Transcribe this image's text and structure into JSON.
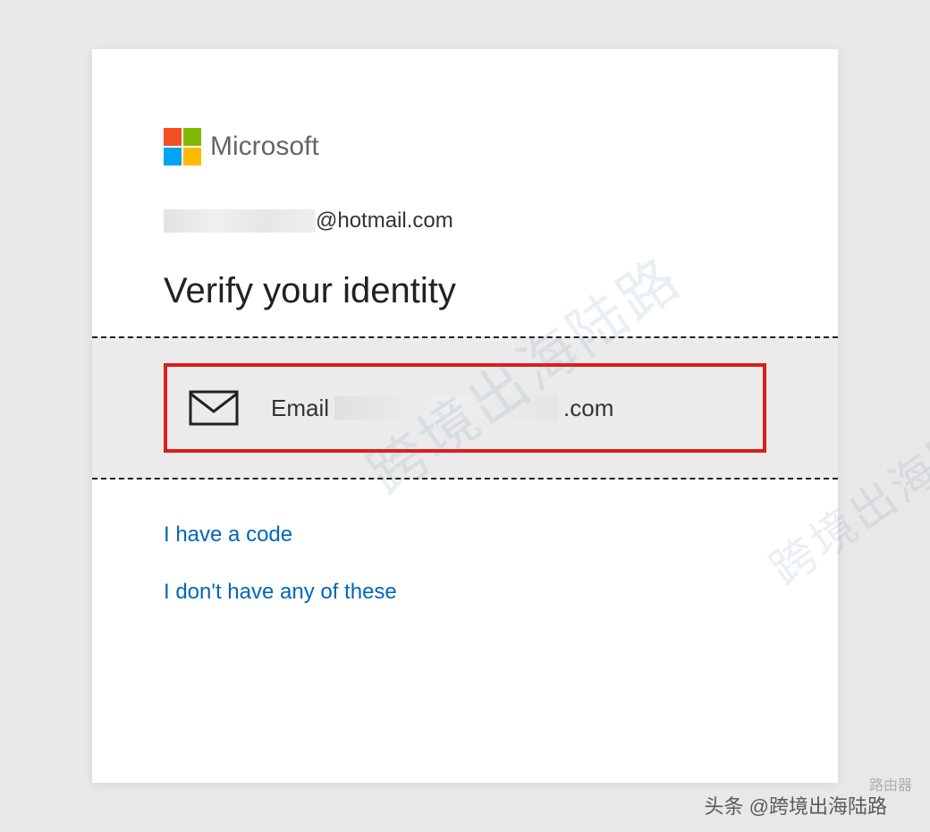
{
  "brand": {
    "name": "Microsoft"
  },
  "account": {
    "redacted_prefix": "",
    "domain": "@hotmail.com"
  },
  "title": "Verify your identity",
  "option": {
    "prefix": "Email",
    "suffix": ".com"
  },
  "links": {
    "have_code": "I have a code",
    "none": "I don't have any of these"
  },
  "watermark": "跨境出海陆路",
  "attribution": "头条 @跨境出海陆路",
  "router_tag": "路由器"
}
